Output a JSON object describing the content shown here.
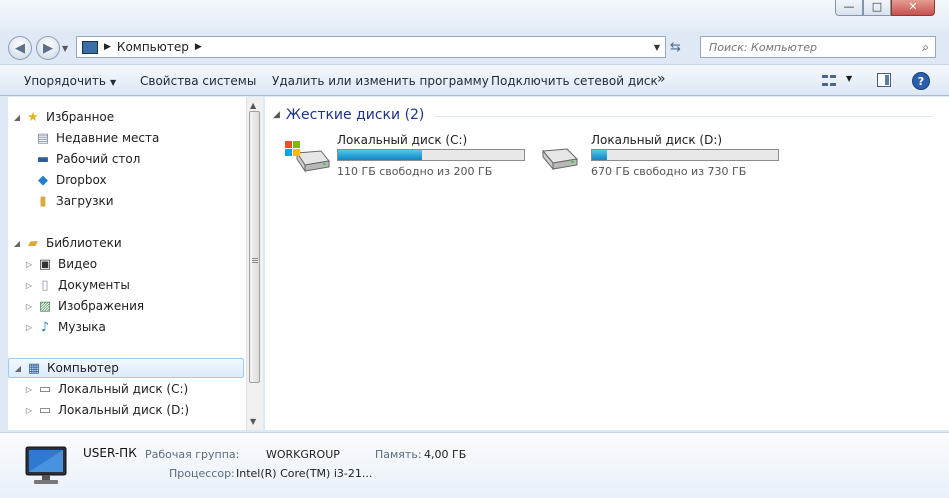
{
  "window": {
    "min_glyph": "—",
    "max_glyph": "□",
    "close_glyph": "✕"
  },
  "address": {
    "path": "Компьютер",
    "search_placeholder": "Поиск: Компьютер"
  },
  "toolbar": {
    "organize": "Упорядочить",
    "system_properties": "Свойства системы",
    "uninstall": "Удалить или изменить программу",
    "map_drive": "Подключить сетевой диск",
    "more": "»",
    "help": "?"
  },
  "navpane": {
    "favorites": "Избранное",
    "recent": "Недавние места",
    "desktop": "Рабочий стол",
    "dropbox": "Dropbox",
    "downloads": "Загрузки",
    "libraries": "Библиотеки",
    "video": "Видео",
    "documents": "Документы",
    "images": "Изображения",
    "music": "Музыка",
    "computer": "Компьютер",
    "drive_c": "Локальный диск (C:)",
    "drive_d": "Локальный диск (D:)"
  },
  "content": {
    "group_header": "Жесткие диски (2)",
    "drives": [
      {
        "name": "Локальный диск (C:)",
        "free_text": "110 ГБ свободно из 200 ГБ",
        "used_fraction": 0.45
      },
      {
        "name": "Локальный диск (D:)",
        "free_text": "670 ГБ свободно из 730 ГБ",
        "used_fraction": 0.08
      }
    ]
  },
  "details": {
    "computer_name": "USER-ПК",
    "workgroup_label": "Рабочая группа:",
    "workgroup_value": "WORKGROUP",
    "memory_label": "Память:",
    "memory_value": "4,00 ГБ",
    "cpu_label": "Процессор:",
    "cpu_value": "Intel(R) Core(TM) i3-21..."
  },
  "colors": {
    "accent": "#25a0d6",
    "group_header": "#1e3287"
  }
}
